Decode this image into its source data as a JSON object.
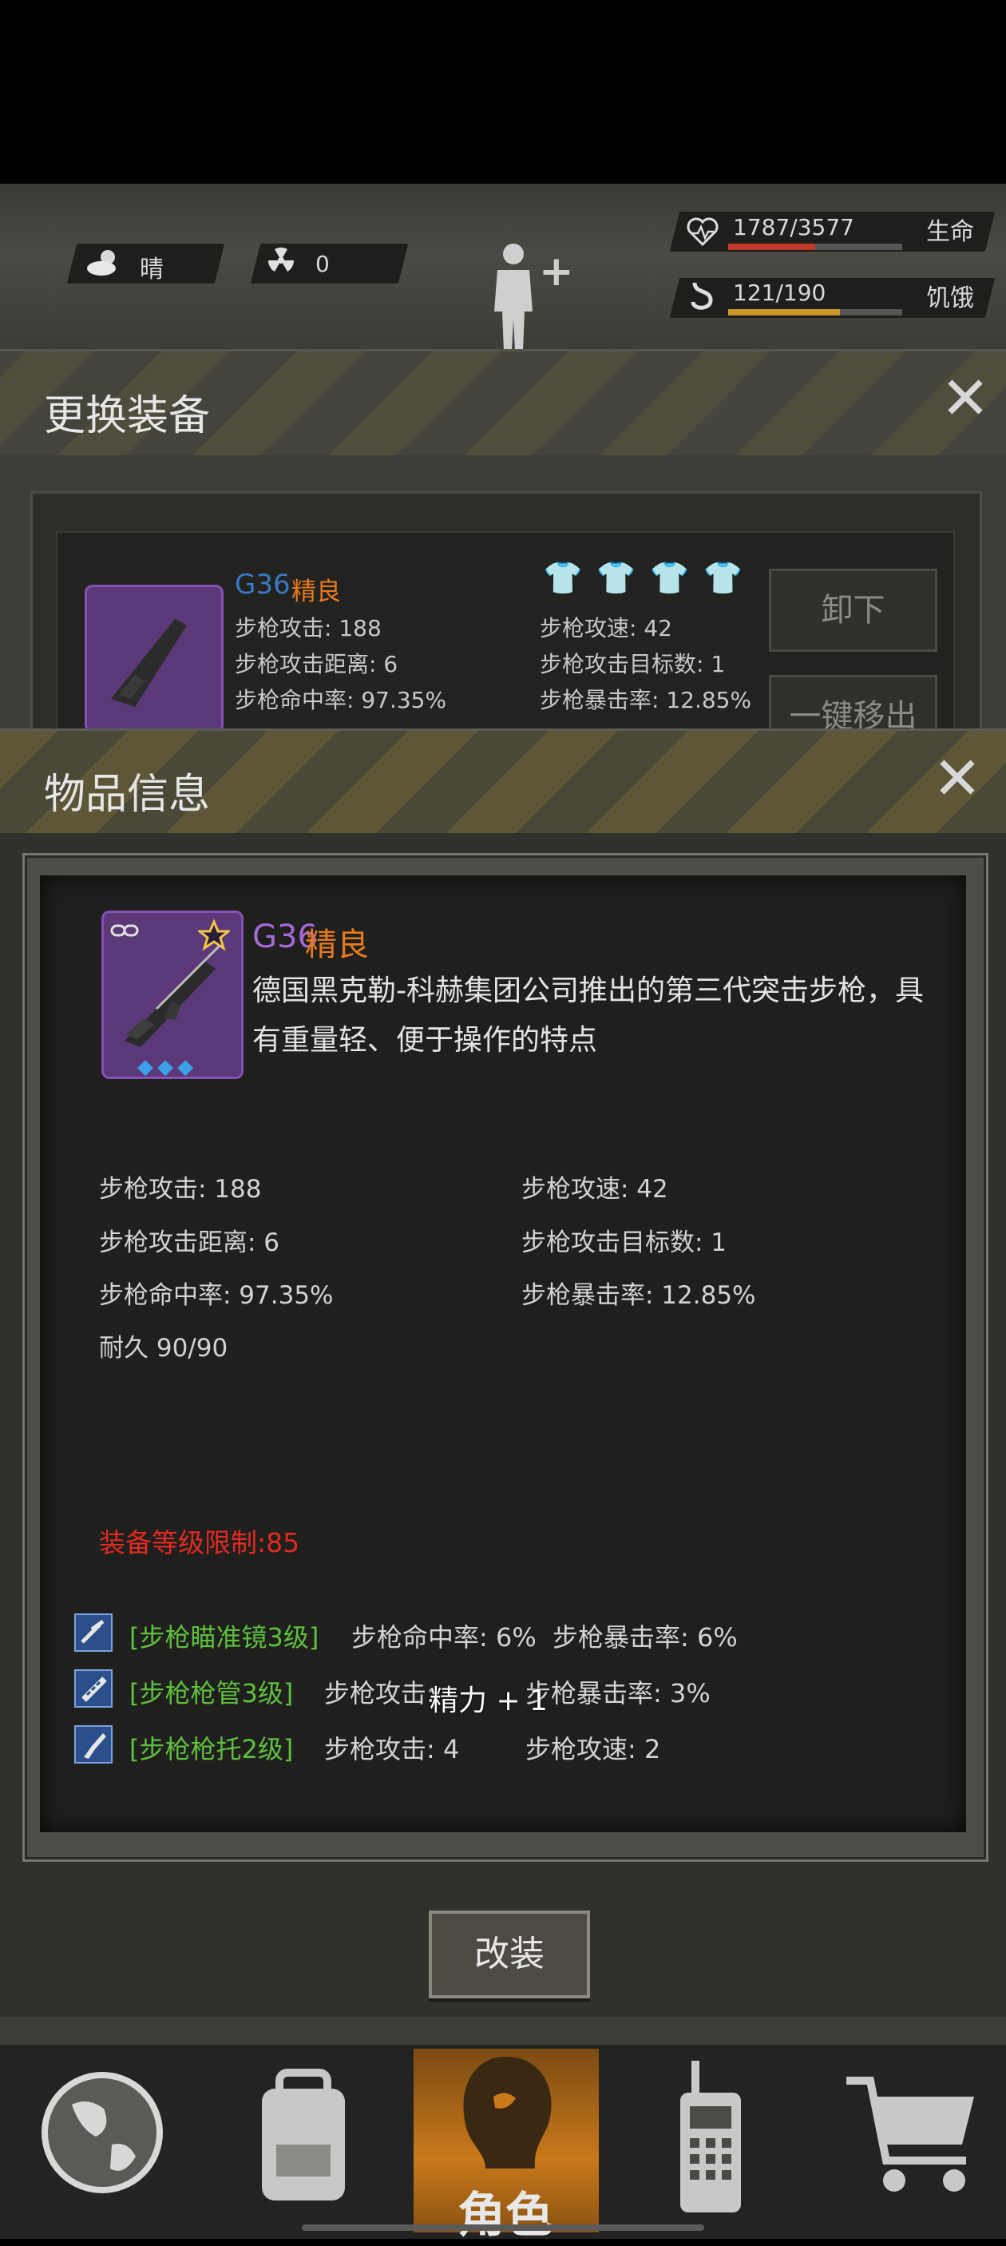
{
  "hud": {
    "weather_label": "晴",
    "radiation_value": "0",
    "health": {
      "text": "1787/3577",
      "label": "生命",
      "fraction": 0.5,
      "color": "#c0392b"
    },
    "hunger": {
      "text": "121/190",
      "label": "饥饿",
      "fraction": 0.64,
      "color": "#c9962a"
    }
  },
  "equip_panel": {
    "title": "更换装备",
    "weapon_name": "G36",
    "weapon_quality": "精良",
    "stats": [
      "步枪攻击: 188",
      "步枪攻速: 42",
      "步枪攻击距离: 6",
      "步枪攻击目标数: 1",
      "步枪命中率: 97.35%",
      "步枪暴击率: 12.85%"
    ],
    "unequip_label": "卸下",
    "remove_all_label": "一键移出"
  },
  "modal": {
    "title": "物品信息",
    "item_name": "G36",
    "item_quality": "精良",
    "description": "德国黑克勒-科赫集团公司推出的第三代突击步枪，具有重量轻、便于操作的特点",
    "stats": {
      "attack": "步枪攻击: 188",
      "speed": "步枪攻速: 42",
      "range": "步枪攻击距离: 6",
      "targets": "步枪攻击目标数: 1",
      "accuracy": "步枪命中率: 97.35%",
      "crit": "步枪暴击率: 12.85%",
      "durability": "耐久 90/90"
    },
    "level_requirement": "装备等级限制:85",
    "mods": [
      {
        "name": "[步枪瞄准镜3级]",
        "stat1": "步枪命中率: 6%",
        "stat2": "步枪暴击率: 6%",
        "icon": "scope-icon"
      },
      {
        "name": "[步枪枪管3级]",
        "stat1": "步枪攻击:",
        "stat2": "步枪暴击率: 3%",
        "icon": "barrel-icon"
      },
      {
        "name": "[步枪枪托2级]",
        "stat1": "步枪攻击: 4",
        "stat2": "步枪攻速: 2",
        "icon": "stock-icon"
      }
    ],
    "floating_text": "精力 + 1",
    "modify_button": "改装"
  },
  "nav": {
    "role_label": "角色",
    "items": [
      "map-globe-icon",
      "backpack-icon",
      "role-head-icon",
      "walkie-talkie-icon",
      "shop-cart-icon"
    ]
  },
  "colors": {
    "quality_orange": "#e87a1e",
    "item_name_purple": "#a36ad6",
    "requirement_red": "#e02a22",
    "mod_green": "#5fbf3e"
  }
}
